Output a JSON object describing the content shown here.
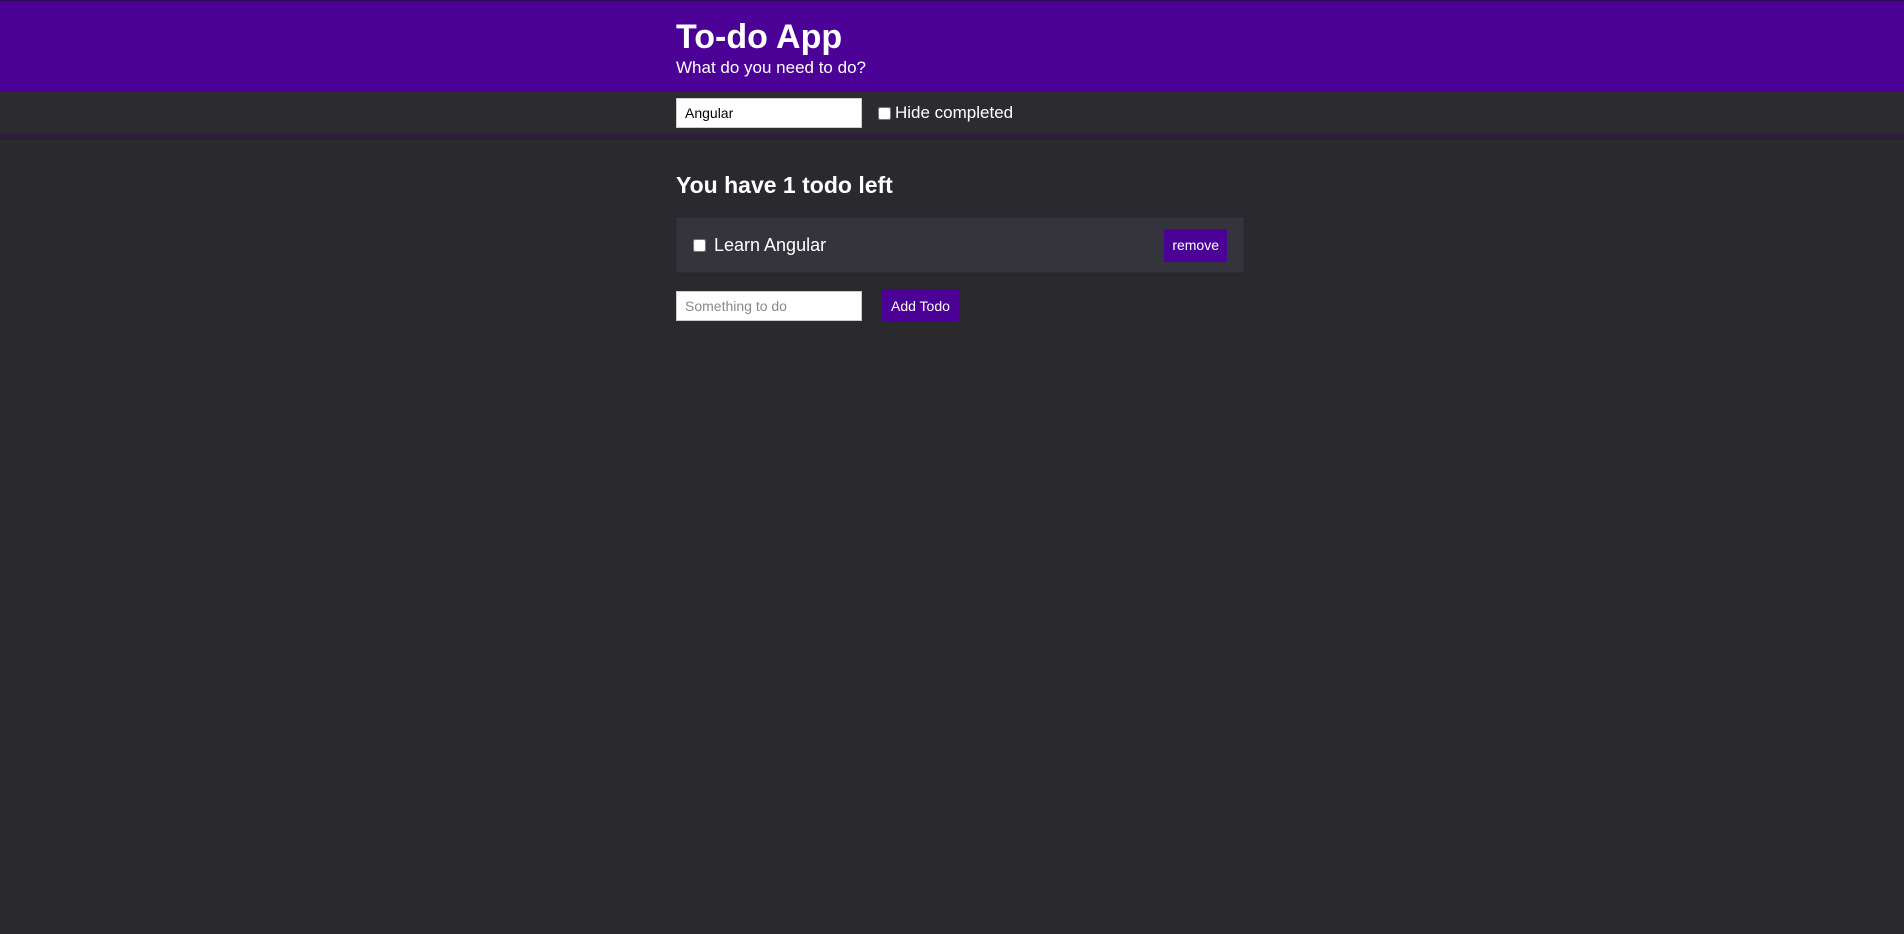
{
  "header": {
    "title": "To-do App",
    "subtitle": "What do you need to do?"
  },
  "filter": {
    "search_value": "Angular",
    "hide_completed_label": "Hide completed",
    "hide_completed_checked": false
  },
  "todos": {
    "heading": "You have 1 todo left",
    "items": [
      {
        "label": "Learn Angular",
        "done": false,
        "remove_label": "remove"
      }
    ]
  },
  "add": {
    "placeholder": "Something to do",
    "value": "",
    "button_label": "Add Todo"
  },
  "colors": {
    "accent": "#4b0096",
    "background": "#2a292e",
    "item_background": "#35333b"
  }
}
